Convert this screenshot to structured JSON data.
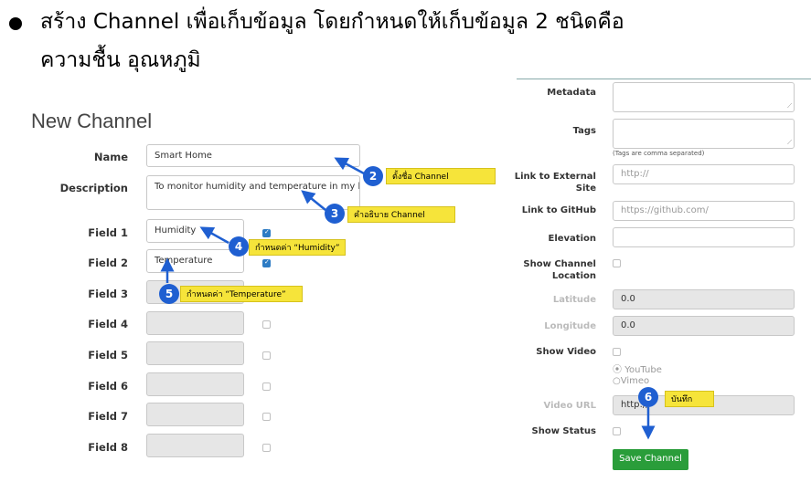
{
  "heading": {
    "line1": "สร้าง Channel เพื่อเก็บข้อมูล โดยกำหนดให้เก็บข้อมูล 2 ชนิดคือ",
    "line2": "ความชื้น อุณหภูมิ"
  },
  "form_title": "New Channel",
  "left": {
    "name_label": "Name",
    "name_value": "Smart Home",
    "description_label": "Description",
    "description_value": "To monitor humidity and temperature in my home",
    "fields": [
      {
        "label": "Field 1",
        "value": "Humidity",
        "checked": true
      },
      {
        "label": "Field 2",
        "value": "Temperature",
        "checked": true
      },
      {
        "label": "Field 3",
        "value": "",
        "checked": false
      },
      {
        "label": "Field 4",
        "value": "",
        "checked": false
      },
      {
        "label": "Field 5",
        "value": "",
        "checked": false
      },
      {
        "label": "Field 6",
        "value": "",
        "checked": false
      },
      {
        "label": "Field 7",
        "value": "",
        "checked": false
      },
      {
        "label": "Field 8",
        "value": "",
        "checked": false
      }
    ]
  },
  "right": {
    "metadata_label": "Metadata",
    "tags_label": "Tags",
    "tags_note": "(Tags are comma separated)",
    "link_external_label": "Link to External Site",
    "link_external_placeholder": "http://",
    "link_github_label": "Link to GitHub",
    "link_github_placeholder": "https://github.com/",
    "elevation_label": "Elevation",
    "show_location_label": "Show Channel Location",
    "latitude_label": "Latitude",
    "latitude_value": "0.0",
    "longitude_label": "Longitude",
    "longitude_value": "0.0",
    "show_video_label": "Show Video",
    "video_option_youtube": "YouTube",
    "video_option_vimeo": "Vimeo",
    "video_url_label": "Video URL",
    "video_url_value": "http://",
    "show_status_label": "Show Status",
    "save_button": "Save Channel"
  },
  "callouts": [
    {
      "num": "2",
      "text": "ตั้งชื่อ Channel"
    },
    {
      "num": "3",
      "text": "คำอธิบาย Channel"
    },
    {
      "num": "4",
      "text": "กำหนดค่า “Humidity”"
    },
    {
      "num": "5",
      "text": "กำหนดค่า “Temperature”"
    },
    {
      "num": "6",
      "text": "บันทึก"
    }
  ],
  "colors": {
    "badge": "#1f5fd1",
    "callout": "#f6e43a",
    "save_button": "#2a9d3a",
    "checkbox_on": "#2e7cc4"
  }
}
